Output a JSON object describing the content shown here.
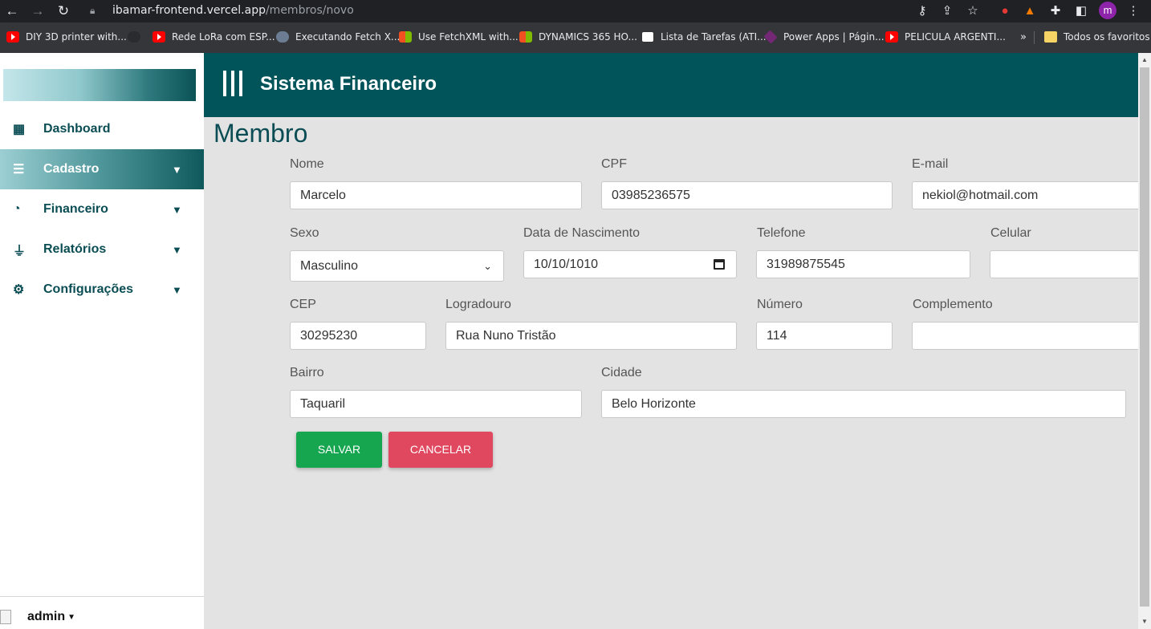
{
  "browser": {
    "url_host": "ibamar-frontend.vercel.app",
    "url_path": "/membros/novo",
    "profile_initial": "m",
    "bookmarks": [
      {
        "label": "DIY 3D printer with...",
        "icon": "youtube-icon"
      },
      {
        "label": "Rede LoRa com ESP...",
        "icon": "youtube-icon"
      },
      {
        "label": "Executando Fetch X...",
        "icon": "cloud-icon"
      },
      {
        "label": "Use FetchXML with...",
        "icon": "microsoft-icon"
      },
      {
        "label": "DYNAMICS 365 HO...",
        "icon": "microsoft-icon"
      },
      {
        "label": "Lista de Tarefas (ATI...",
        "icon": "notion-icon"
      },
      {
        "label": "Power Apps | Págin...",
        "icon": "power-apps-icon"
      },
      {
        "label": "PELICULA ARGENTI...",
        "icon": "youtube-icon"
      }
    ],
    "more_bookmarks": "»",
    "all_bookmarks": "Todos os favoritos"
  },
  "sidebar": {
    "items": [
      {
        "label": "Dashboard",
        "icon": "grid-icon",
        "active": false
      },
      {
        "label": "Cadastro",
        "icon": "stack-icon",
        "active": true
      },
      {
        "label": "Financeiro",
        "icon": "pie-chart-icon",
        "active": false
      },
      {
        "label": "Relatórios",
        "icon": "plug-icon",
        "active": false
      },
      {
        "label": "Configurações",
        "icon": "gear-icon",
        "active": false
      }
    ],
    "user": "admin"
  },
  "header": {
    "title": "Sistema Financeiro"
  },
  "form": {
    "title": "Membro",
    "fields": {
      "nome": {
        "label": "Nome",
        "value": "Marcelo"
      },
      "cpf": {
        "label": "CPF",
        "value": "03985236575"
      },
      "email": {
        "label": "E-mail",
        "value": "nekiol@hotmail.com"
      },
      "sexo": {
        "label": "Sexo",
        "value": "Masculino"
      },
      "nascimento": {
        "label": "Data de Nascimento",
        "value": "10/10/1010"
      },
      "telefone": {
        "label": "Telefone",
        "value": "31989875545"
      },
      "celular": {
        "label": "Celular",
        "value": ""
      },
      "cep": {
        "label": "CEP",
        "value": "30295230"
      },
      "logradouro": {
        "label": "Logradouro",
        "value": "Rua Nuno Tristão"
      },
      "numero": {
        "label": "Número",
        "value": "114"
      },
      "complemento": {
        "label": "Complemento",
        "value": ""
      },
      "bairro": {
        "label": "Bairro",
        "value": "Taquaril"
      },
      "cidade": {
        "label": "Cidade",
        "value": "Belo Horizonte"
      }
    },
    "save_label": "SALVAR",
    "cancel_label": "CANCELAR"
  },
  "colors": {
    "header_bg": "#01545a",
    "save": "#17a650",
    "cancel": "#e0485f",
    "title_text": "#0b4d54"
  }
}
